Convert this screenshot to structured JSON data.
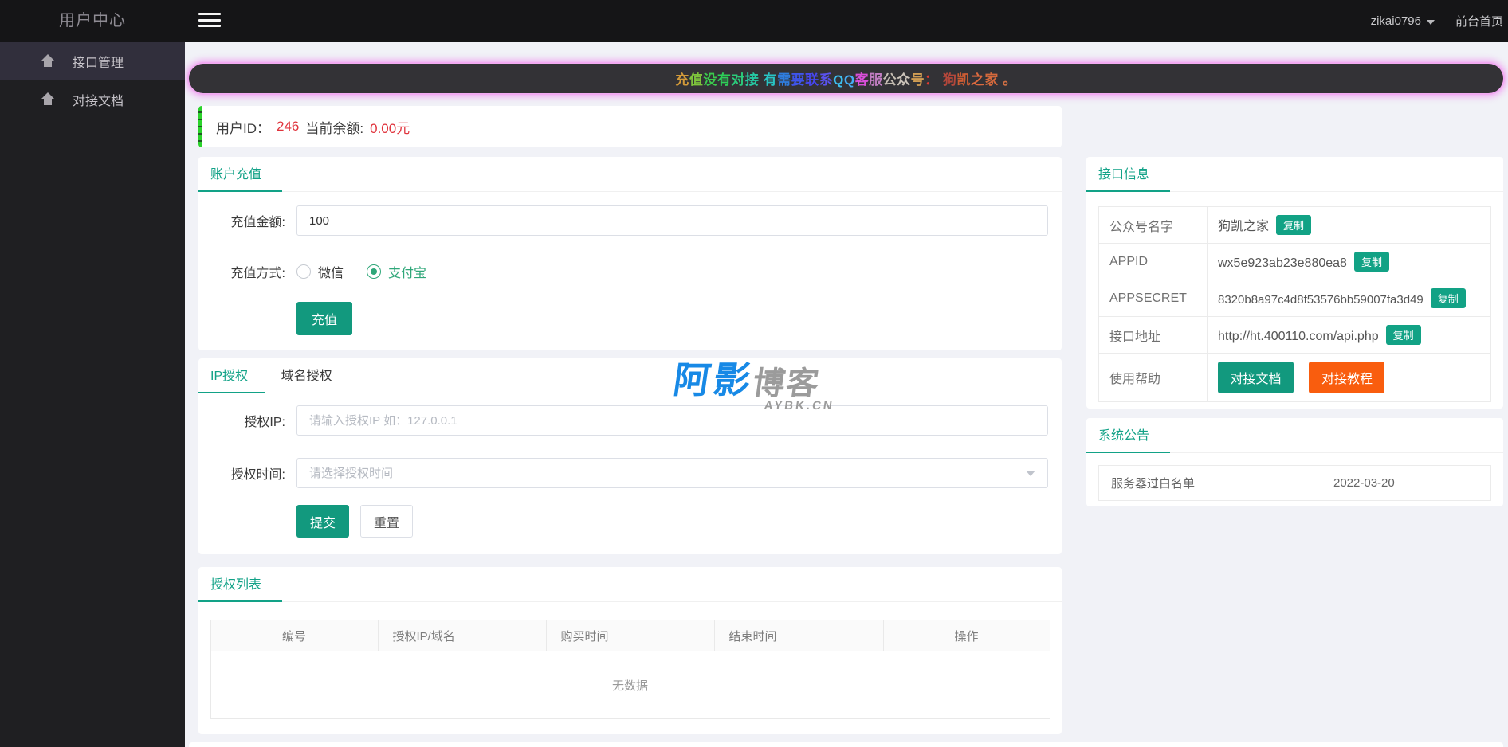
{
  "header": {
    "brand": "用户中心",
    "user": "zikai0796",
    "home_link": "前台首页"
  },
  "sidebar": {
    "items": [
      {
        "label": "接口管理"
      },
      {
        "label": "对接文档"
      }
    ]
  },
  "notice_banner": {
    "chars": [
      {
        "t": "充",
        "c": "#d29a3a"
      },
      {
        "t": "值",
        "c": "#7ec43c"
      },
      {
        "t": "没",
        "c": "#3bc94d"
      },
      {
        "t": "有",
        "c": "#2ecf58"
      },
      {
        "t": "对",
        "c": "#2bcc7c"
      },
      {
        "t": "接",
        "c": "#26c9a4"
      },
      {
        "t": " ",
        "c": "#ffffff"
      },
      {
        "t": "有",
        "c": "#29c4c4"
      },
      {
        "t": "需",
        "c": "#2f7de0"
      },
      {
        "t": "要",
        "c": "#3f55ec"
      },
      {
        "t": "联",
        "c": "#4747f0"
      },
      {
        "t": "系",
        "c": "#5a52f0"
      },
      {
        "t": "Q",
        "c": "#3dc0f0"
      },
      {
        "t": "Q",
        "c": "#46aef5"
      },
      {
        "t": "客",
        "c": "#d94fd9"
      },
      {
        "t": "服",
        "c": "#c27ec2"
      },
      {
        "t": "公",
        "c": "#c5bdb2"
      },
      {
        "t": "众",
        "c": "#ccc4ba"
      },
      {
        "t": "号",
        "c": "#d09c53"
      },
      {
        "t": "：",
        "c": "#e03a32"
      },
      {
        "t": " ",
        "c": "#ffffff"
      },
      {
        "t": "狗",
        "c": "#b4473b"
      },
      {
        "t": "凯",
        "c": "#cc5c33"
      },
      {
        "t": "之",
        "c": "#dd6a3f"
      },
      {
        "t": "家",
        "c": "#d4693c"
      },
      {
        "t": " ",
        "c": "#ffffff"
      },
      {
        "t": "。",
        "c": "#cf6f44"
      }
    ]
  },
  "user_info": {
    "id_label": "用户ID：",
    "id_value": "246",
    "balance_label": "当前余额:",
    "balance_value": "0.00元"
  },
  "recharge": {
    "title": "账户充值",
    "amount_label": "充值金额:",
    "amount_value": "100",
    "method_label": "充值方式:",
    "methods": [
      {
        "label": "微信"
      },
      {
        "label": "支付宝"
      }
    ],
    "submit_label": "充值"
  },
  "authorization": {
    "tabs": [
      {
        "label": "IP授权"
      },
      {
        "label": "域名授权"
      }
    ],
    "ip_label": "授权IP:",
    "ip_placeholder": "请输入授权IP 如：127.0.0.1",
    "time_label": "授权时间:",
    "time_placeholder": "请选择授权时间",
    "submit_label": "提交",
    "reset_label": "重置"
  },
  "auth_list": {
    "title": "授权列表",
    "columns": [
      "编号",
      "授权IP/域名",
      "购买时间",
      "结束时间",
      "操作"
    ],
    "empty_text": "无数据"
  },
  "api_info": {
    "title": "接口信息",
    "rows": [
      {
        "label": "公众号名字",
        "value": "狗凯之家",
        "copy": "复制"
      },
      {
        "label": "APPID",
        "value": "wx5e923ab23e880ea8",
        "copy": "复制"
      },
      {
        "label": "APPSECRET",
        "value": "8320b8a97c4d8f53576bb59007fa3d49",
        "copy": "复制"
      },
      {
        "label": "接口地址",
        "value": "http://ht.400110.com/api.php",
        "copy": "复制"
      }
    ],
    "help_label": "使用帮助",
    "help_buttons": [
      {
        "label": "对接文档"
      },
      {
        "label": "对接教程"
      }
    ]
  },
  "announcements": {
    "title": "系统公告",
    "rows": [
      {
        "title": "服务器过白名单",
        "date": "2022-03-20"
      }
    ]
  },
  "watermark": {
    "part1": "阿影",
    "part2": "博客",
    "sub": "AYBK.CN"
  },
  "colors": {
    "accent_green": "#12a287",
    "button_teal": "#12997e",
    "button_orange": "#f95d0e",
    "alert_red": "#e0333c",
    "banner_glow": "#ee82ee"
  }
}
